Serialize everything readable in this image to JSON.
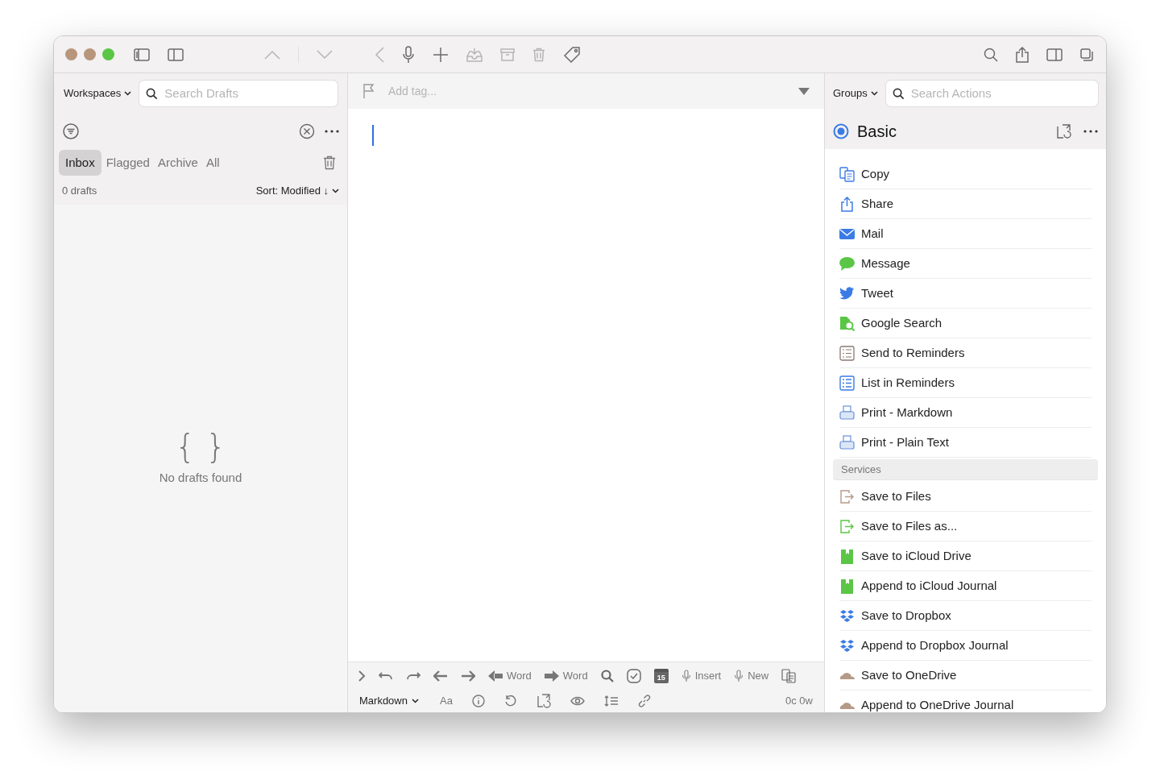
{
  "sidebar": {
    "workspaces_button": "Workspaces",
    "search": {
      "placeholder": "Search Drafts"
    },
    "tabs": [
      {
        "label": "Inbox",
        "selected": true
      },
      {
        "label": "Flagged",
        "selected": false
      },
      {
        "label": "Archive",
        "selected": false
      },
      {
        "label": "All",
        "selected": false
      }
    ],
    "count": "0 drafts",
    "sort": "Sort: Modified ↓",
    "empty_glyph": "{ }",
    "empty_message": "No drafts found"
  },
  "editor": {
    "tag_placeholder": "Add tag...",
    "toolbar": [
      {
        "kind": "back-word",
        "label": "Word"
      },
      {
        "kind": "forward-word",
        "label": "Word"
      },
      {
        "kind": "calendar",
        "label": "15"
      },
      {
        "kind": "dictate-insert",
        "label": "Insert"
      },
      {
        "kind": "dictate-new",
        "label": "New"
      }
    ],
    "mode": "Markdown",
    "font_button": "Aa",
    "counts": "0c 0w"
  },
  "actions": {
    "groups_button": "Groups",
    "search": {
      "placeholder": "Search Actions"
    },
    "group_title": "Basic",
    "items": [
      {
        "kind": "action",
        "label": "Copy"
      },
      {
        "kind": "action",
        "label": "Share"
      },
      {
        "kind": "action",
        "label": "Mail"
      },
      {
        "kind": "action",
        "label": "Message"
      },
      {
        "kind": "action",
        "label": "Tweet"
      },
      {
        "kind": "action",
        "label": "Google Search"
      },
      {
        "kind": "action",
        "label": "Send to Reminders"
      },
      {
        "kind": "action",
        "label": "List in Reminders"
      },
      {
        "kind": "action",
        "label": "Print - Markdown"
      },
      {
        "kind": "action",
        "label": "Print - Plain Text"
      },
      {
        "kind": "section",
        "label": "Services"
      },
      {
        "kind": "action",
        "label": "Save to Files"
      },
      {
        "kind": "action",
        "label": "Save to Files as..."
      },
      {
        "kind": "action",
        "label": "Save to iCloud Drive"
      },
      {
        "kind": "action",
        "label": "Append to iCloud Journal"
      },
      {
        "kind": "action",
        "label": "Save to Dropbox"
      },
      {
        "kind": "action",
        "label": "Append to Dropbox Journal"
      },
      {
        "kind": "action",
        "label": "Save to OneDrive"
      },
      {
        "kind": "action",
        "label": "Append to OneDrive Journal"
      }
    ]
  }
}
